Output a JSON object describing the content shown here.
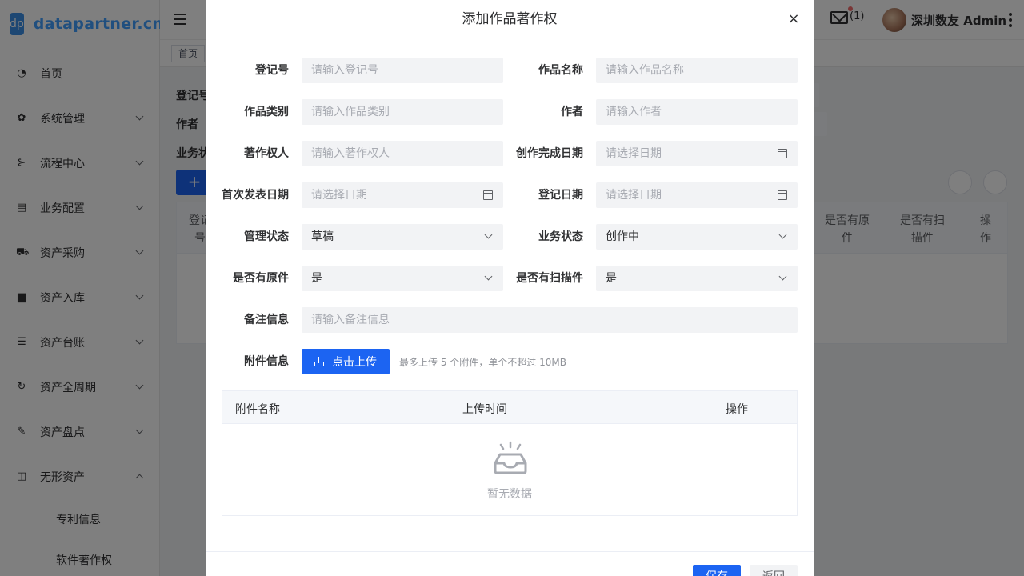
{
  "app": {
    "logo_badge": "dp",
    "logo_text": "datapartner.cn"
  },
  "sidebar": {
    "items": [
      {
        "label": "首页",
        "icon": "dashboard-icon"
      },
      {
        "label": "系统管理",
        "icon": "gear-icon"
      },
      {
        "label": "流程中心",
        "icon": "flow-icon"
      },
      {
        "label": "业务配置",
        "icon": "config-icon"
      },
      {
        "label": "资产采购",
        "icon": "cart-icon"
      },
      {
        "label": "资产入库",
        "icon": "clapper-icon"
      },
      {
        "label": "资产台账",
        "icon": "list-icon"
      },
      {
        "label": "资产全周期",
        "icon": "cycle-icon"
      },
      {
        "label": "资产盘点",
        "icon": "edit-icon"
      },
      {
        "label": "无形资产",
        "icon": "book-icon"
      }
    ],
    "sub_items": [
      "专利信息",
      "软件著作权"
    ]
  },
  "header": {
    "mail_count": "(1)",
    "user_name": "深圳数友 Admin"
  },
  "background": {
    "tag": "首页",
    "labels": [
      "登记号",
      "作者",
      "业务状"
    ],
    "add_button": "+",
    "table_headers": [
      "登记号",
      "是否有原件",
      "是否有扫描件",
      "操作"
    ]
  },
  "dialog": {
    "title": "添加作品著作权",
    "close": "×",
    "fields": {
      "reg_no": {
        "label": "登记号",
        "placeholder": "请输入登记号"
      },
      "work_name": {
        "label": "作品名称",
        "placeholder": "请输入作品名称"
      },
      "category": {
        "label": "作品类别",
        "placeholder": "请输入作品类别"
      },
      "author": {
        "label": "作者",
        "placeholder": "请输入作者"
      },
      "owner": {
        "label": "著作权人",
        "placeholder": "请输入著作权人"
      },
      "complete_date": {
        "label": "创作完成日期",
        "placeholder": "请选择日期"
      },
      "publish_date": {
        "label": "首次发表日期",
        "placeholder": "请选择日期"
      },
      "reg_date": {
        "label": "登记日期",
        "placeholder": "请选择日期"
      },
      "manage_status": {
        "label": "管理状态",
        "value": "草稿"
      },
      "biz_status": {
        "label": "业务状态",
        "value": "创作中"
      },
      "has_original": {
        "label": "是否有原件",
        "value": "是"
      },
      "has_scan": {
        "label": "是否有扫描件",
        "value": "是"
      },
      "remark": {
        "label": "备注信息",
        "placeholder": "请输入备注信息"
      },
      "attachment": {
        "label": "附件信息"
      }
    },
    "upload": {
      "label": "点击上传",
      "tip": "最多上传 5 个附件，单个不超过 10MB"
    },
    "attachment_table": {
      "headers": [
        "附件名称",
        "上传时间",
        "操作"
      ],
      "empty_text": "暂无数据"
    },
    "footer": {
      "save": "保存",
      "back": "返回"
    }
  }
}
